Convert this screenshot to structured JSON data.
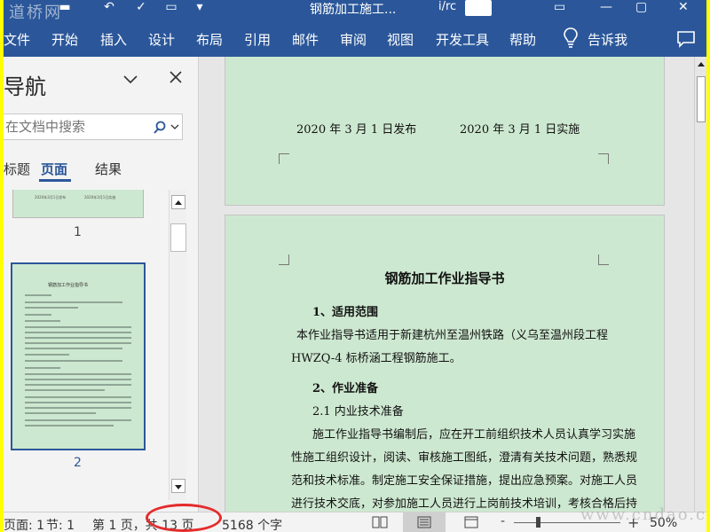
{
  "colors": {
    "frame": "#ffff00",
    "ribbon": "#2b579a",
    "page_bg": "#cde8d0",
    "highlight": "#e52b2b"
  },
  "titlebar": {
    "watermark": "道桥网",
    "doc_title": "钢筋加工施工...",
    "user": "i/rc"
  },
  "menu": [
    "文件",
    "开始",
    "插入",
    "设计",
    "布局",
    "引用",
    "邮件",
    "审阅",
    "视图",
    "开发工具",
    "帮助",
    "告诉我"
  ],
  "nav": {
    "title": "导航",
    "search_placeholder": "在文档中搜索",
    "tabs": [
      "标题",
      "页面",
      "结果"
    ],
    "active_tab": "页面",
    "thumb1_texts": [
      "2020年3月1日发布",
      "2020年3月1日实施"
    ],
    "thumb2_title": "钢筋加工作业指导书",
    "pages": [
      "1",
      "2"
    ]
  },
  "document": {
    "publish_date": "2020 年 3 月 1 日发布",
    "implement_date": "2020 年 3 月 1 日实施",
    "heading": "钢筋加工作业指导书",
    "lines": [
      "1、适用范围",
      "本作业指导书适用于新建杭州至温州铁路（义乌至温州段工程",
      "HWZQ-4 标桥涵工程钢筋施工。",
      "2、作业准备",
      "2.1 内业技术准备",
      "施工作业指导书编制后，应在开工前组织技术人员认真学习实施",
      "性施工组织设计，阅读、审核施工图纸，澄清有关技术问题，熟悉规",
      "范和技术标准。制定施工安全保证措施，提出应急预案。对施工人员",
      "进行技术交底，对参加施工人员进行上岗前技术培训，考核合格后持"
    ]
  },
  "status": {
    "section_prefix": "页面: 1",
    "section": "节: 1",
    "page_pos": "第 1 页，共 13 页",
    "word_count": "5168 个字",
    "zoom": "50%",
    "zoom_minus": "-",
    "zoom_plus": "+"
  },
  "watermark_bottom": "www.cndao.com",
  "icons": [
    "lightbulb-icon",
    "comment-icon",
    "chevron-down-icon",
    "close-icon",
    "search-icon",
    "read-mode-icon",
    "print-layout-icon",
    "web-layout-icon"
  ]
}
